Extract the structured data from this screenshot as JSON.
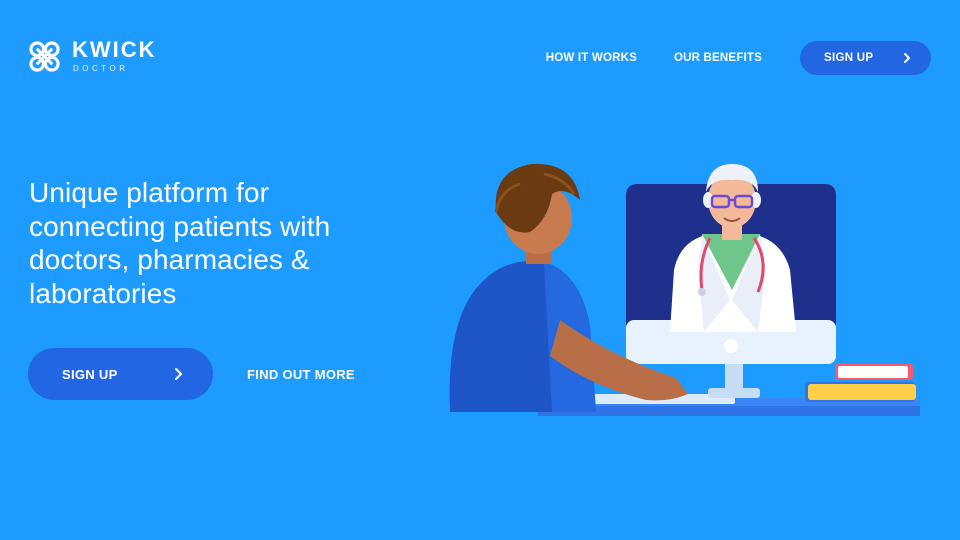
{
  "brand": {
    "name": "KWICK",
    "tagline": "DOCTOR"
  },
  "nav": {
    "items": [
      {
        "label": "HOW IT WORKS"
      },
      {
        "label": "OUR BENEFITS"
      }
    ],
    "signup_label": "SIGN UP"
  },
  "hero": {
    "headline_lines": [
      "Unique platform for",
      "connecting patients with",
      "doctors, pharmacies &",
      "laboratories"
    ],
    "primary_cta": "SIGN UP",
    "secondary_cta": "FIND OUT MORE"
  },
  "colors": {
    "background": "#1e9bff",
    "button": "#2266e4",
    "text": "#ffffff"
  },
  "icons": {
    "logo": "cross-heart-logo-icon",
    "chevron": "chevron-right-icon"
  }
}
